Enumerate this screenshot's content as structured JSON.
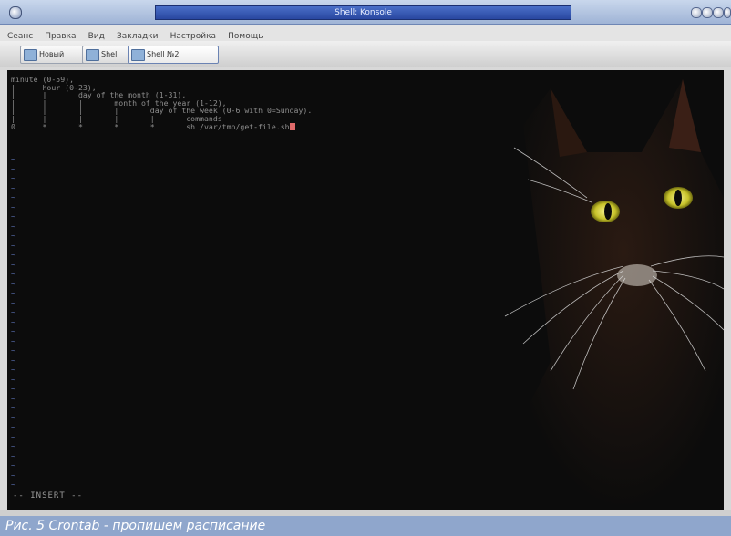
{
  "window": {
    "title": "Shell: Konsole"
  },
  "menu": [
    "Сеанс",
    "Правка",
    "Вид",
    "Закладки",
    "Настройка",
    "Помощь"
  ],
  "tabs": [
    {
      "label": "Новый"
    },
    {
      "label": "Shell"
    },
    {
      "label": "Shell №2"
    }
  ],
  "terminal": {
    "lines": [
      "minute (0-59),",
      "|      hour (0-23),",
      "|      |       day of the month (1-31),",
      "|      |       |       month of the year (1-12),",
      "|      |       |       |       day of the week (0-6 with 0=Sunday).",
      "|      |       |       |       |       commands",
      "0      *       *       *       *       sh /var/tmp/get-file.sh"
    ],
    "mode": "-- INSERT --"
  },
  "caption": "Рис. 5 Crontab - пропишем расписание"
}
